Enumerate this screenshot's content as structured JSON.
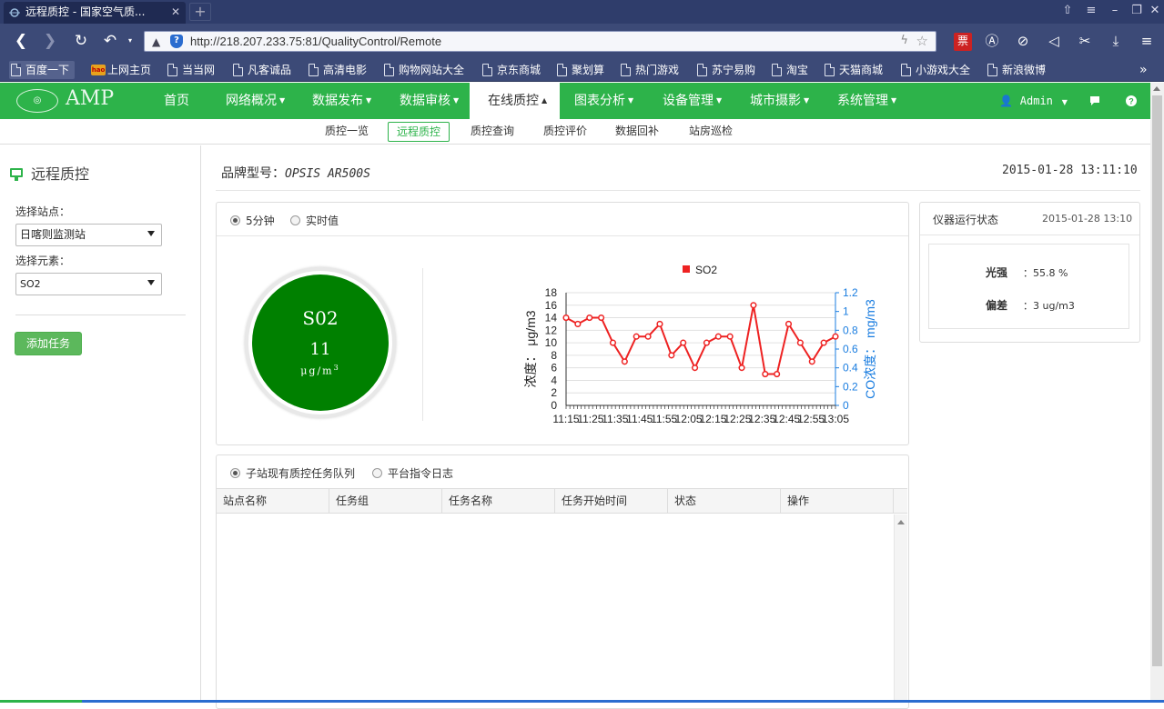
{
  "browser": {
    "tab_title": "远程质控 - 国家空气质...",
    "tab_close": "✕",
    "new_tab": "+",
    "url": "http://218.207.233.75:81/QualityControl/Remote",
    "bookmarks": [
      "百度一下",
      "上网主页",
      "当当网",
      "凡客诚品",
      "高清电影",
      "购物网站大全",
      "京东商城",
      "聚划算",
      "热门游戏",
      "苏宁易购",
      "淘宝",
      "天猫商城",
      "小游戏大全",
      "新浪微博"
    ],
    "hao_badge": "hao",
    "ext_ticket": "票"
  },
  "app": {
    "logo_text": "AMP",
    "menu": [
      {
        "label": "首页",
        "dropdown": false
      },
      {
        "label": "网络概况",
        "dropdown": true
      },
      {
        "label": "数据发布",
        "dropdown": true
      },
      {
        "label": "数据审核",
        "dropdown": true
      },
      {
        "label": "在线质控",
        "dropdown": true,
        "active": true
      },
      {
        "label": "图表分析",
        "dropdown": true
      },
      {
        "label": "设备管理",
        "dropdown": true
      },
      {
        "label": "城市摄影",
        "dropdown": true
      },
      {
        "label": "系统管理",
        "dropdown": true
      }
    ],
    "user": "Admin",
    "submenu": [
      "质控一览",
      "远程质控",
      "质控查询",
      "质控评价",
      "数据回补",
      "站房巡检"
    ],
    "active_submenu": "远程质控"
  },
  "sidebar": {
    "title": "远程质控",
    "station_label": "选择站点：",
    "station_value": "日喀则监测站",
    "element_label": "选择元素：",
    "element_value": "SO2",
    "add_button": "添加任务"
  },
  "main": {
    "brand_label": "品牌型号：",
    "brand_value": "OPSIS AR500S",
    "datetime": "2015-01-28 13:11:10",
    "radio_5min": "5分钟",
    "radio_realtime": "实时值",
    "gauge": {
      "name": "S02",
      "value": "11",
      "unit": "μg/m",
      "unit_sup": "3",
      "color": "#008000"
    }
  },
  "status": {
    "title": "仪器运行状态",
    "time": "2015-01-28 13:10",
    "light_label": "光强",
    "light_value": "：55.8 %",
    "deviation_label": "偏差",
    "deviation_value": "：3 ug/m3"
  },
  "tasks": {
    "radio_queue": "子站现有质控任务队列",
    "radio_log": "平台指令日志",
    "columns": [
      "站点名称",
      "任务组",
      "任务名称",
      "任务开始时间",
      "状态",
      "操作"
    ]
  },
  "chart_data": {
    "type": "line",
    "series": [
      {
        "name": "SO2",
        "color": "#ee2222",
        "values": [
          14,
          13,
          14,
          14,
          10,
          7,
          11,
          11,
          13,
          8,
          10,
          6,
          10,
          11,
          11,
          6,
          16,
          5,
          5,
          13,
          10,
          7,
          10,
          11
        ]
      }
    ],
    "x_tick_labels": [
      "11:15",
      "11:25",
      "11:35",
      "11:45",
      "11:55",
      "12:05",
      "12:15",
      "12:25",
      "12:35",
      "12:45",
      "12:55",
      "13:05"
    ],
    "ylabel": "浓度： μg/m3",
    "y2label": "CO浓度： mg/m3",
    "ylim": [
      0,
      18
    ],
    "yticks": [
      0,
      2,
      4,
      6,
      8,
      10,
      12,
      14,
      16,
      18
    ],
    "y2lim": [
      0,
      1.2
    ],
    "y2ticks": [
      "0",
      "0.2",
      "0.4",
      "0.6",
      "0.8",
      "1",
      "1.2"
    ],
    "grid": true,
    "legend": "top"
  }
}
